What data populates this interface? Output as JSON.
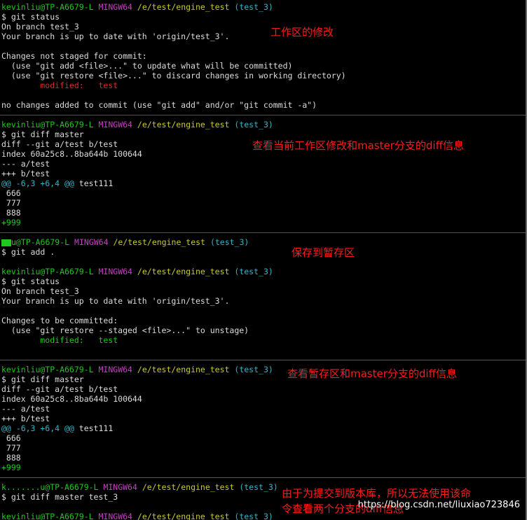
{
  "prompts": {
    "p1": {
      "user": "kevinliu@TP-A6679-L",
      "env": "MINGW64",
      "path": "/e/test/engine_test",
      "branch": "(test_3)"
    },
    "p2": {
      "user": "kevinliu@TP-A6679-L",
      "env": "MINGW64",
      "path": "/e/test/engine_test",
      "branch": "(test_3)"
    },
    "p3": {
      "user": "u@TP-A6679-L",
      "env": "MINGW64",
      "path": "/e/test/engine_test",
      "branch": "(test_3)"
    },
    "p4": {
      "user": "kevinliu@TP-A6679-L",
      "env": "MINGW64",
      "path": "/e/test/engine_test",
      "branch": "(test_3)"
    },
    "p5": {
      "user": "kevinliu@TP-A6679-L",
      "env": "MINGW64",
      "path": "/e/test/engine_test",
      "branch": "(test_3)"
    },
    "p6": {
      "user": "k.......u@TP-A6679-L",
      "env": "MINGW64",
      "path": "/e/test/engine_test",
      "branch": "(test_3)"
    },
    "p7": {
      "user": "kevinliu@TP-A6679-L",
      "env": "MINGW64",
      "path": "/e/test/engine_test",
      "branch": "(test_3)"
    }
  },
  "lines": {
    "cmd_status1": "$ git status",
    "on_branch1": "On branch test_3",
    "uptodate1": "Your branch is up to date with 'origin/test_3'.",
    "not_staged": "Changes not staged for commit:",
    "hint_add": "  (use \"git add <file>...\" to update what will be committed)",
    "hint_restore": "  (use \"git restore <file>...\" to discard changes in working directory)",
    "modified1_label": "        modified:   ",
    "modified1_file": "test",
    "no_changes": "no changes added to commit (use \"git add\" and/or \"git commit -a\")",
    "cmd_diff1": "$ git diff master",
    "diff_git1": "diff --git a/test b/test",
    "index1": "index 60a25c8..8ba644b 100644",
    "minus1": "--- a/test",
    "plus1": "+++ b/test",
    "hunk1": "@@ -6,3 +6,4 @@",
    "hunk1_ctx": " test111",
    "ctx1_a": " 666",
    "ctx1_b": " 777",
    "ctx1_c": " 888",
    "add1": "+999",
    "cmd_add": "$ git add .",
    "cmd_status2": "$ git status",
    "on_branch2": "On branch test_3",
    "uptodate2": "Your branch is up to date with 'origin/test_3'.",
    "to_be_committed": "Changes to be committed:",
    "hint_unstage": "  (use \"git restore --staged <file>...\" to unstage)",
    "modified2_label": "        modified:   ",
    "modified2_file": "test",
    "cmd_diff2": "$ git diff master",
    "diff_git2": "diff --git a/test b/test",
    "index2": "index 60a25c8..8ba644b 100644",
    "minus2": "--- a/test",
    "plus2": "+++ b/test",
    "hunk2": "@@ -6,3 +6,4 @@",
    "hunk2_ctx": " test111",
    "ctx2_a": " 666",
    "ctx2_b": " 777",
    "ctx2_c": " 888",
    "add2": "+999",
    "cmd_diff3": "$ git diff master test_3"
  },
  "annotations": {
    "a1": "工作区的修改",
    "a2": "查看当前工作区修改和master分支的diff信息",
    "a3": "保存到暂存区",
    "a4": "查看暂存区和master分支的diff信息",
    "a5_line1": "由于为提交到版本库，所以无法使用该命",
    "a5_line2": "令查看两个分支的diff信息"
  },
  "watermark": "https://blog.csdn.net/liuxiao723846",
  "colors": {
    "background": "#000000",
    "user": "#1ec81e",
    "env": "#c044c0",
    "path": "#c8c832",
    "branch": "#32b4c8",
    "modified": "#d22d2d",
    "staged": "#1ec81e",
    "annotation": "#ff1a1a"
  }
}
